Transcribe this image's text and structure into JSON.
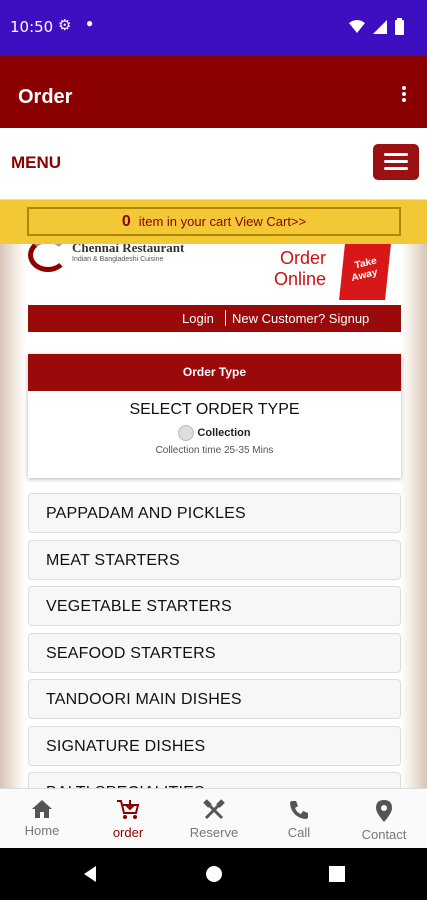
{
  "status_bar": {
    "time": "10:50"
  },
  "app_bar": {
    "title": "Order"
  },
  "menu_bar": {
    "label": "MENU"
  },
  "cart": {
    "count": "0",
    "text": "item in your cart View Cart>>"
  },
  "logo": {
    "name": "Chennai Restaurant",
    "sub": "Indian & Bangladeshi Cuisine",
    "order_online_1": "Order",
    "order_online_2": "Online",
    "bag_1": "Take",
    "bag_2": "Away"
  },
  "account": {
    "login": "Login",
    "signup": "New Customer? Signup"
  },
  "order_type": {
    "header": "Order Type",
    "title": "SELECT ORDER TYPE",
    "option": "Collection",
    "time": "Collection time 25-35 Mins"
  },
  "categories": [
    "PAPPADAM AND PICKLES",
    "MEAT STARTERS",
    "VEGETABLE STARTERS",
    "SEAFOOD STARTERS",
    "TANDOORI MAIN DISHES",
    "SIGNATURE DISHES",
    "BALTI SPECIALITIES"
  ],
  "bottom_nav": [
    {
      "label": "Home",
      "icon": "home-icon"
    },
    {
      "label": "order",
      "icon": "cart-icon",
      "active": true
    },
    {
      "label": "Reserve",
      "icon": "fork-knife-icon"
    },
    {
      "label": "Call",
      "icon": "phone-icon"
    },
    {
      "label": "Contact",
      "icon": "location-pin-icon"
    }
  ],
  "colors": {
    "status_bar": "#3d0fc0",
    "brand": "#8b0000",
    "cart_bar": "#f3c836"
  }
}
